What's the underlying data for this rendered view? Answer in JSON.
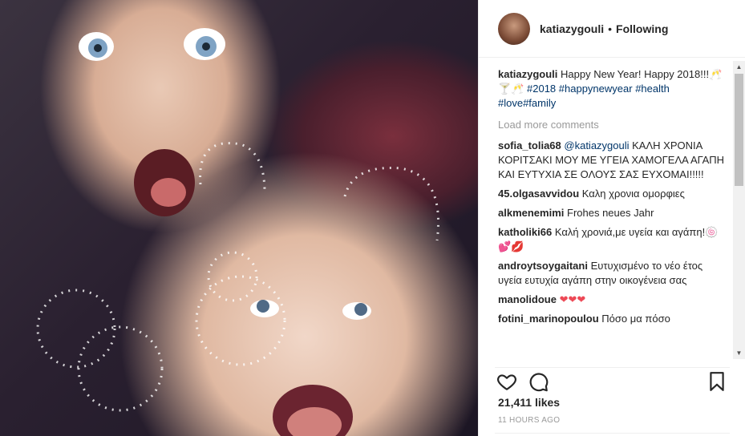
{
  "post": {
    "username": "katiazygouli",
    "separator": "•",
    "follow_status": "Following",
    "caption": {
      "text": "Happy New Year! Happy 2018!!!🥂🍸🥂",
      "hashtags": [
        "#2018",
        "#happynewyear",
        "#health",
        "#love#family"
      ]
    },
    "load_more": "Load more comments",
    "comments": [
      {
        "user": "sofia_tolia68",
        "mention": "@katiazygouli",
        "text": "ΚΑΛΗ ΧΡΟΝΙΑ ΚΟΡΙΤΣΑΚΙ ΜΟΥ ΜΕ ΥΓΕΙΑ ΧΑΜΟΓΕΛΑ ΑΓΑΠΗ ΚΑΙ ΕΥΤΥΧΙΑ ΣΕ ΟΛΟΥΣ ΣΑΣ ΕΥΧΟΜΑΙ!!!!!"
      },
      {
        "user": "45.olgasavvidou",
        "text": "Καλη χρονια ομορφιες"
      },
      {
        "user": "alkmenemimi",
        "text": "Frohes neues Jahr"
      },
      {
        "user": "katholiki66",
        "text": "Καλή χρονιά,με υγεία και αγάπη!🍥💕💋"
      },
      {
        "user": "androytsoygaitani",
        "text": "Ευτυχισμένο το νέο έτος υγεία ευτυχία αγάπη στην οικογένεια σας"
      },
      {
        "user": "manolidoue",
        "text": "❤❤❤"
      },
      {
        "user": "fotini_marinopoulou",
        "text": "Πόσο μα πόσο"
      }
    ],
    "likes": "21,411 likes",
    "timestamp": "11 HOURS AGO"
  },
  "scrollbar": {
    "up_arrow": "▲",
    "down_arrow": "▼"
  },
  "icons": {
    "like": "heart-icon",
    "comment": "comment-icon",
    "save": "bookmark-icon"
  },
  "colors": {
    "link": "#003569",
    "muted": "#999999",
    "heart": "#ed4956"
  }
}
